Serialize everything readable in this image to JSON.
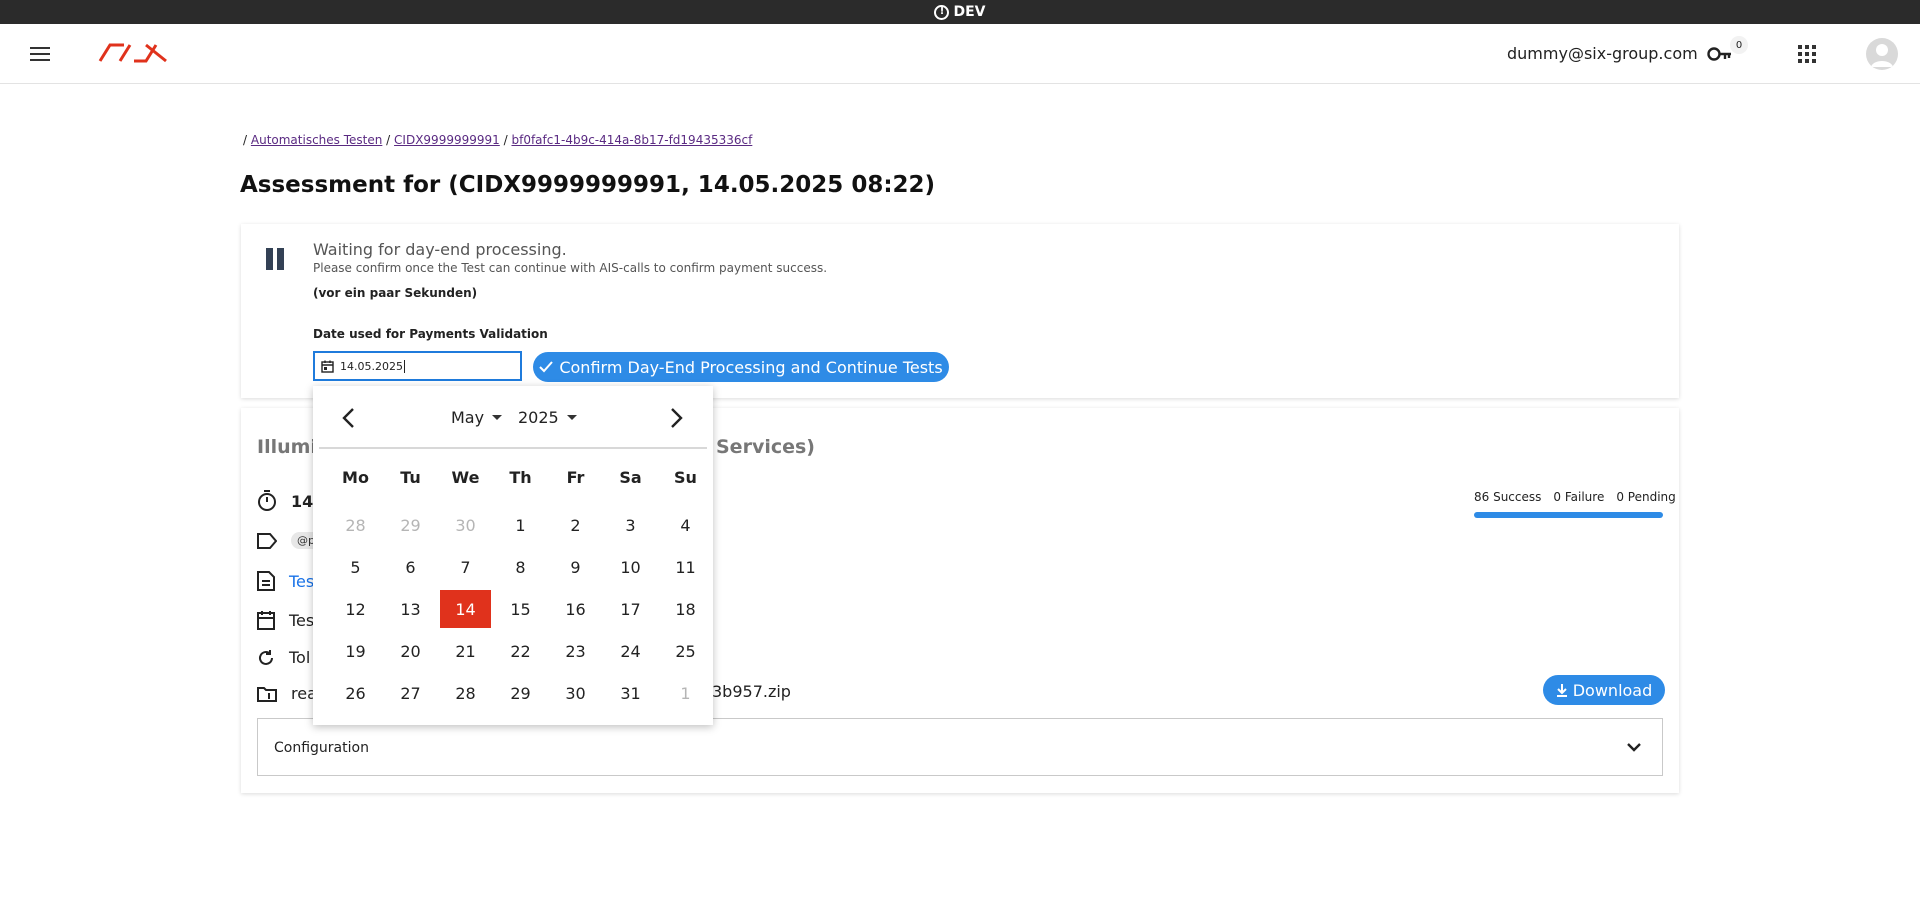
{
  "env": {
    "label": "DEV",
    "icon": "alert-circle-icon"
  },
  "header": {
    "logo_text": "SIX",
    "user_email": "dummy@six-group.com",
    "key_badge": "0",
    "icons": [
      "menu-icon",
      "key-icon",
      "apps-grid-icon",
      "user-avatar-icon"
    ]
  },
  "breadcrumb": {
    "sep": "/",
    "items": [
      "Automatisches Testen",
      "CIDX9999999991",
      "bf0fafc1-4b9c-414a-8b17-fd19435336cf"
    ]
  },
  "page_title": "Assessment for (CIDX9999999991, 14.05.2025 08:22)",
  "status_card": {
    "title": "Waiting for day-end processing.",
    "subtitle": "Please confirm once the Test can continue with AIS-calls to confirm payment success.",
    "time_ago": "(vor ein paar Sekunden)",
    "date_label": "Date used for Payments Validation",
    "date_value": "14.05.2025",
    "confirm_label": "Confirm Day-End Processing and Continue Tests"
  },
  "detail_card": {
    "title_start": "Illumi",
    "title_end": "Services)",
    "rows": {
      "timer": "14.",
      "tag": "@p",
      "doc": "Tes",
      "calendar": "Tes",
      "refresh": "Tol",
      "folder": "rea"
    },
    "zip_suffix": "3b957.zip",
    "stats": {
      "success": "86 Success",
      "failure": "0 Failure",
      "pending": "0 Pending"
    },
    "progress_success_fraction": 1.0,
    "download_label": "Download",
    "config_label": "Configuration"
  },
  "datepicker": {
    "month": "May",
    "year": "2025",
    "weekdays": [
      "Mo",
      "Tu",
      "We",
      "Th",
      "Fr",
      "Sa",
      "Su"
    ],
    "weeks": [
      [
        {
          "d": "28",
          "m": true
        },
        {
          "d": "29",
          "m": true
        },
        {
          "d": "30",
          "m": true
        },
        {
          "d": "1"
        },
        {
          "d": "2"
        },
        {
          "d": "3"
        },
        {
          "d": "4"
        }
      ],
      [
        {
          "d": "5"
        },
        {
          "d": "6"
        },
        {
          "d": "7"
        },
        {
          "d": "8"
        },
        {
          "d": "9"
        },
        {
          "d": "10"
        },
        {
          "d": "11"
        }
      ],
      [
        {
          "d": "12"
        },
        {
          "d": "13"
        },
        {
          "d": "14",
          "sel": true
        },
        {
          "d": "15"
        },
        {
          "d": "16"
        },
        {
          "d": "17"
        },
        {
          "d": "18"
        }
      ],
      [
        {
          "d": "19"
        },
        {
          "d": "20"
        },
        {
          "d": "21"
        },
        {
          "d": "22"
        },
        {
          "d": "23"
        },
        {
          "d": "24"
        },
        {
          "d": "25"
        }
      ],
      [
        {
          "d": "26"
        },
        {
          "d": "27"
        },
        {
          "d": "28"
        },
        {
          "d": "29"
        },
        {
          "d": "30"
        },
        {
          "d": "31"
        },
        {
          "d": "1",
          "m": true
        }
      ]
    ]
  },
  "colors": {
    "primary": "#2e8be6",
    "selected": "#e0321c",
    "brand": "#e0321c",
    "link": "#5a2a82"
  }
}
